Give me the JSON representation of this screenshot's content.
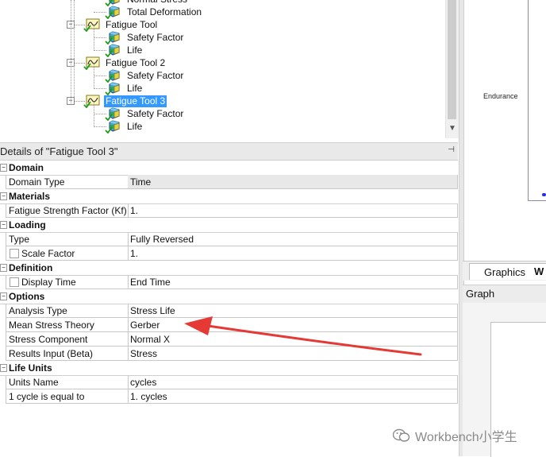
{
  "tree": {
    "items": [
      {
        "label": "Normal Stress",
        "level": 2
      },
      {
        "label": "Total Deformation",
        "level": 2
      },
      {
        "label": "Fatigue Tool",
        "level": 1
      },
      {
        "label": "Safety Factor",
        "level": 2
      },
      {
        "label": "Life",
        "level": 2
      },
      {
        "label": "Fatigue Tool 2",
        "level": 1
      },
      {
        "label": "Safety Factor",
        "level": 2
      },
      {
        "label": "Life",
        "level": 2
      },
      {
        "label": "Fatigue Tool 3",
        "level": 1,
        "selected": true
      },
      {
        "label": "Safety Factor",
        "level": 2
      },
      {
        "label": "Life",
        "level": 2
      }
    ]
  },
  "details": {
    "title": "Details of \"Fatigue Tool 3\"",
    "pin_glyph": "⊣",
    "sections": [
      {
        "header": "Domain",
        "rows": [
          {
            "name": "Domain Type",
            "value": "Time",
            "highlight": true
          }
        ]
      },
      {
        "header": "Materials",
        "rows": [
          {
            "name": "Fatigue Strength Factor (Kf)",
            "value": "1."
          }
        ]
      },
      {
        "header": "Loading",
        "rows": [
          {
            "name": "Type",
            "value": "Fully Reversed"
          },
          {
            "name": "Scale Factor",
            "value": "1.",
            "checkbox": true
          }
        ]
      },
      {
        "header": "Definition",
        "rows": [
          {
            "name": "Display Time",
            "value": "End Time",
            "checkbox": true
          }
        ]
      },
      {
        "header": "Options",
        "rows": [
          {
            "name": "Analysis Type",
            "value": "Stress Life"
          },
          {
            "name": "Mean Stress Theory",
            "value": "Gerber"
          },
          {
            "name": "Stress Component",
            "value": "Normal X"
          },
          {
            "name": "Results Input (Beta)",
            "value": "Stress"
          }
        ]
      },
      {
        "header": "Life Units",
        "rows": [
          {
            "name": "Units Name",
            "value": "cycles"
          },
          {
            "name": "1 cycle is equal to",
            "value": "1. cycles"
          }
        ]
      }
    ]
  },
  "graphics": {
    "endurance_label": "Endurance"
  },
  "tabs": {
    "graphics": "Graphics",
    "worksheet_partial": "W"
  },
  "graph": {
    "title": "Graph"
  },
  "watermark": {
    "text": "Workbench小学生"
  },
  "colors": {
    "selection": "#3399ff",
    "annotation_arrow": "#e53935",
    "check": "#1a9c1a"
  }
}
